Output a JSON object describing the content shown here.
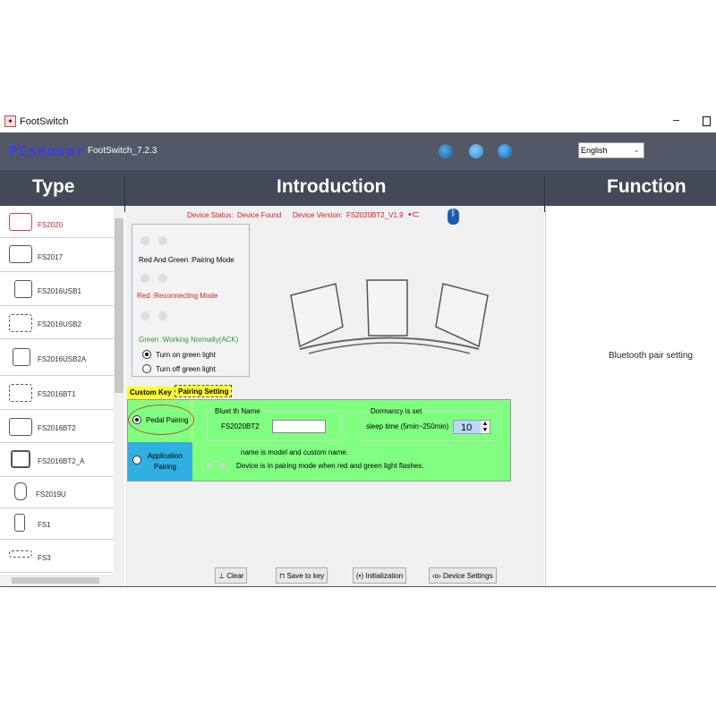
{
  "window": {
    "title": "FootSwitch",
    "minimize": "–"
  },
  "header": {
    "logo": "PCsensor",
    "version": "FootSwitch_7.2.3",
    "language": "English",
    "icons": [
      "play-icon",
      "help-icon",
      "refresh-icon"
    ]
  },
  "columns": {
    "type": "Type",
    "introduction": "Introduction",
    "function": "Function"
  },
  "sidebar": {
    "items": [
      {
        "label": "FS2020",
        "selected": true
      },
      {
        "label": "FS2017"
      },
      {
        "label": "FS2016USB1"
      },
      {
        "label": "FS2016USB2"
      },
      {
        "label": "FS2016USB2A"
      },
      {
        "label": "FS2016BT1"
      },
      {
        "label": "FS2016BT2"
      },
      {
        "label": "FS2016BT2_A"
      },
      {
        "label": "FS2019U"
      },
      {
        "label": "FS1"
      },
      {
        "label": "FS3"
      }
    ]
  },
  "status": {
    "status_label": "Device Status:",
    "status_value": "Device Found",
    "version_label": "Device Version:",
    "version_value": "FS2020BT2_V1.9"
  },
  "legend": {
    "pairing": "Red And Green :Pairing Mode",
    "reconnecting": "Red :Reconnecting Mode",
    "working": "Green :Working Normally(ACK)",
    "turn_on": "Turn on green light",
    "turn_off": "Turn off green light",
    "turn_on_selected": true
  },
  "tabs": {
    "custom_key": "Custom Key",
    "pairing_setting": "Pairing Setting"
  },
  "pairing": {
    "pedal": "Pedal Pairing",
    "application": "Application Pairing",
    "pedal_selected": true,
    "bt_group": "Bluet    th Name",
    "bt_model": "FS2020BT2",
    "bt_custom": "",
    "dormancy_group": "Dormancy is set",
    "sleep_label": "sleep time  (5min~250min)",
    "sleep_value": "10",
    "note1": "name is model and custom name.",
    "note2": "Device is in pairing mode when red and green light flashes."
  },
  "buttons": {
    "clear": "Clear",
    "save": "Save to key",
    "init": "Initialization",
    "device": "Device Settings"
  },
  "function": {
    "text": "Bluetooth pair setting"
  },
  "colors": {
    "header": "#525867",
    "columns": "#434957",
    "panel": "#80ff80",
    "app_pairing": "#30b0e0",
    "tab": "#ffff30",
    "accent_red": "#d0202a"
  }
}
